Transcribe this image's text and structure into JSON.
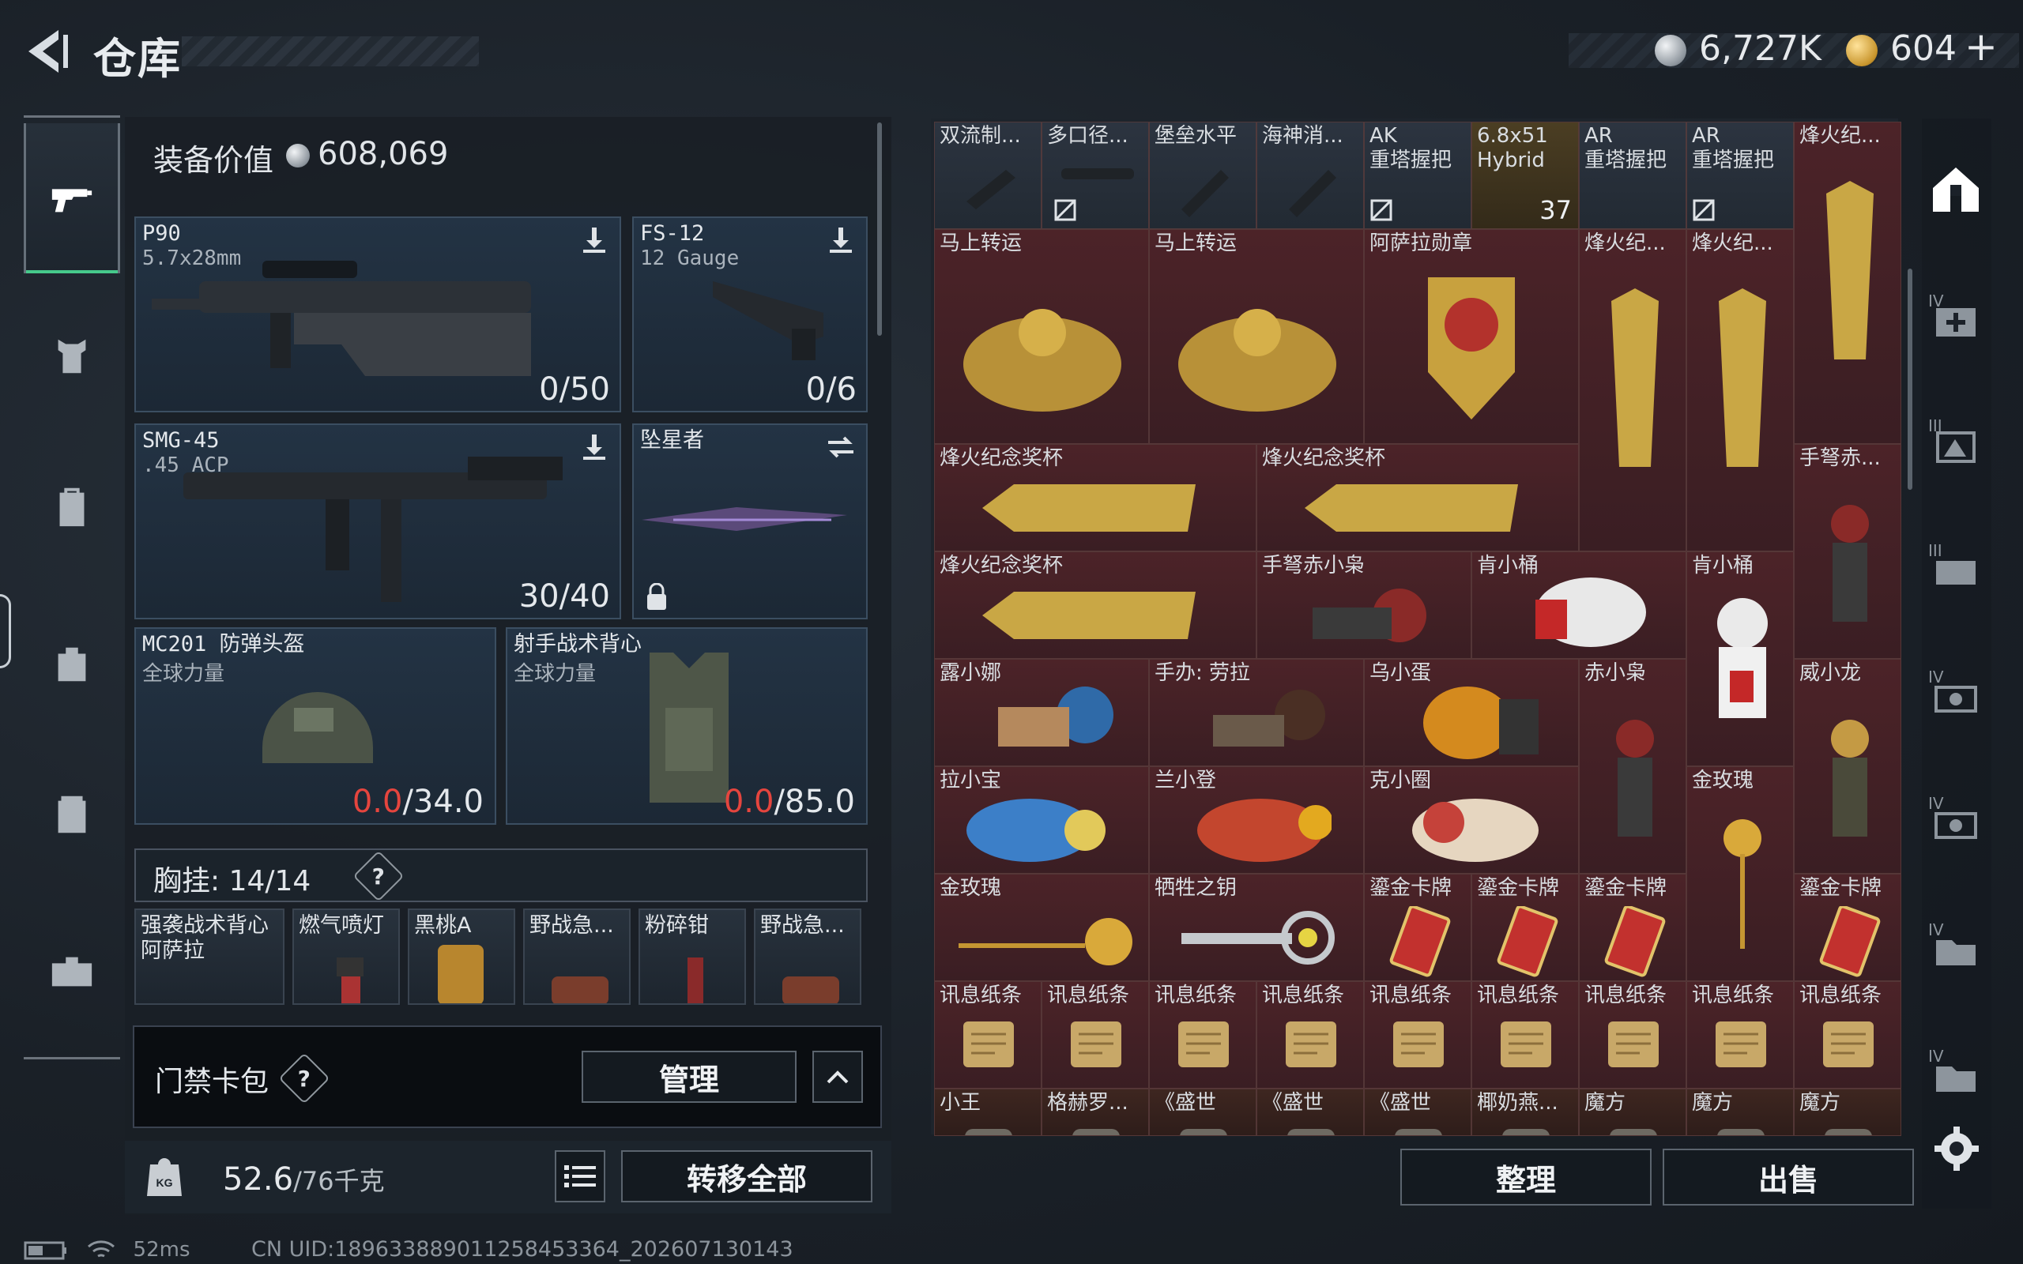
{
  "header": {
    "title": "仓库",
    "silver_amount": "6,727K",
    "gold_amount": "604",
    "add_label": "+"
  },
  "equipment": {
    "label": "装备价值",
    "value": "608,069",
    "primary": {
      "name": "P90",
      "caliber": "5.7x28mm",
      "ammo": "0/50"
    },
    "secondary": {
      "name": "FS-12",
      "caliber": "12 Gauge",
      "ammo": "0/6"
    },
    "smg": {
      "name": "SMG-45",
      "caliber": ".45 ACP",
      "ammo": "30/40"
    },
    "melee": {
      "name": "坠星者"
    },
    "helmet": {
      "name": "MC201 防弹头盔",
      "brand": "全球力量",
      "dur_cur": "0.0",
      "dur_max": "/34.0"
    },
    "vest": {
      "name": "射手战术背心",
      "brand": "全球力量",
      "dur_cur": "0.0",
      "dur_max": "/85.0"
    }
  },
  "chest_rig": {
    "label": "胸挂:",
    "capacity": "14/14",
    "items": [
      "强袭战术背心\n阿萨拉",
      "燃气喷灯",
      "黑桃A",
      "野战急...",
      "粉碎钳",
      "野战急..."
    ]
  },
  "keycard": {
    "label": "门禁卡包",
    "manage": "管理"
  },
  "weight": {
    "current": "52.6",
    "max": "/76千克",
    "transfer_all": "转移全部"
  },
  "inventory": {
    "sort_button": "整理",
    "sell_button": "出售",
    "cells": [
      {
        "name": "双流制...",
        "color": "dark"
      },
      {
        "name": "多口径...",
        "color": "dark"
      },
      {
        "name": "堡垒水平",
        "color": "dark"
      },
      {
        "name": "海神消...",
        "color": "dark"
      },
      {
        "name": "AK\n重塔握把",
        "color": "dark"
      },
      {
        "name": "6.8x51\nHybrid",
        "color": "gold",
        "count": "37"
      },
      {
        "name": "AR\n重塔握把",
        "color": "dark"
      },
      {
        "name": "AR\n重塔握把",
        "color": "dark"
      },
      {
        "name": "烽火纪...",
        "color": "red"
      },
      {
        "name": "马上转运",
        "color": "red"
      },
      {
        "name": "马上转运",
        "color": "red"
      },
      {
        "name": "阿萨拉勋章",
        "color": "red"
      },
      {
        "name": "烽火纪...",
        "color": "red"
      },
      {
        "name": "烽火纪...",
        "color": "red"
      },
      {
        "name": "烽火纪念奖杯",
        "color": "red"
      },
      {
        "name": "烽火纪念奖杯",
        "color": "red"
      },
      {
        "name": "手弩赤...",
        "color": "red"
      },
      {
        "name": "烽火纪念奖杯",
        "color": "red"
      },
      {
        "name": "手弩赤小枭",
        "color": "red"
      },
      {
        "name": "肯小桶",
        "color": "red"
      },
      {
        "name": "肯小桶",
        "color": "red"
      },
      {
        "name": "露小娜",
        "color": "red"
      },
      {
        "name": "手办: 劳拉",
        "color": "red"
      },
      {
        "name": "乌小蛋",
        "color": "red"
      },
      {
        "name": "赤小枭",
        "color": "red"
      },
      {
        "name": "威小龙",
        "color": "red"
      },
      {
        "name": "拉小宝",
        "color": "red"
      },
      {
        "name": "兰小登",
        "color": "red"
      },
      {
        "name": "克小圈",
        "color": "red"
      },
      {
        "name": "金玫瑰",
        "color": "red"
      },
      {
        "name": "金玫瑰",
        "color": "red"
      },
      {
        "name": "牺牲之钥",
        "color": "red"
      },
      {
        "name": "鎏金卡牌",
        "color": "red"
      },
      {
        "name": "鎏金卡牌",
        "color": "red"
      },
      {
        "name": "鎏金卡牌",
        "color": "red"
      },
      {
        "name": "鎏金卡牌",
        "color": "red"
      },
      {
        "name": "讯息纸条",
        "color": "red"
      },
      {
        "name": "讯息纸条",
        "color": "red"
      },
      {
        "name": "讯息纸条",
        "color": "red"
      },
      {
        "name": "讯息纸条",
        "color": "red"
      },
      {
        "name": "讯息纸条",
        "color": "red"
      },
      {
        "name": "讯息纸条",
        "color": "red"
      },
      {
        "name": "讯息纸条",
        "color": "red"
      },
      {
        "name": "讯息纸条",
        "color": "red"
      },
      {
        "name": "讯息纸条",
        "color": "red"
      },
      {
        "name": "小王",
        "color": "brown"
      },
      {
        "name": "格赫罗...",
        "color": "brown"
      },
      {
        "name": "《盛世",
        "color": "brown"
      },
      {
        "name": "《盛世",
        "color": "brown"
      },
      {
        "name": "《盛世",
        "color": "brown"
      },
      {
        "name": "椰奶燕...",
        "color": "brown"
      },
      {
        "name": "魔方",
        "color": "brown"
      },
      {
        "name": "魔方",
        "color": "brown"
      },
      {
        "name": "魔方",
        "color": "brown"
      }
    ]
  },
  "right_nav": [
    "home-icon",
    "tier-4-add-icon",
    "tier-3-storage-icon",
    "tier-3-cases-icon",
    "tier-4-ammo-icon",
    "tier-4-gear-icon",
    "tier-4-folder-icon",
    "tier-4-box-icon",
    "settings-icon"
  ],
  "status_bar": {
    "ping": "52ms",
    "uid": "CN UID:18963388901125845336​4_202607130143"
  }
}
